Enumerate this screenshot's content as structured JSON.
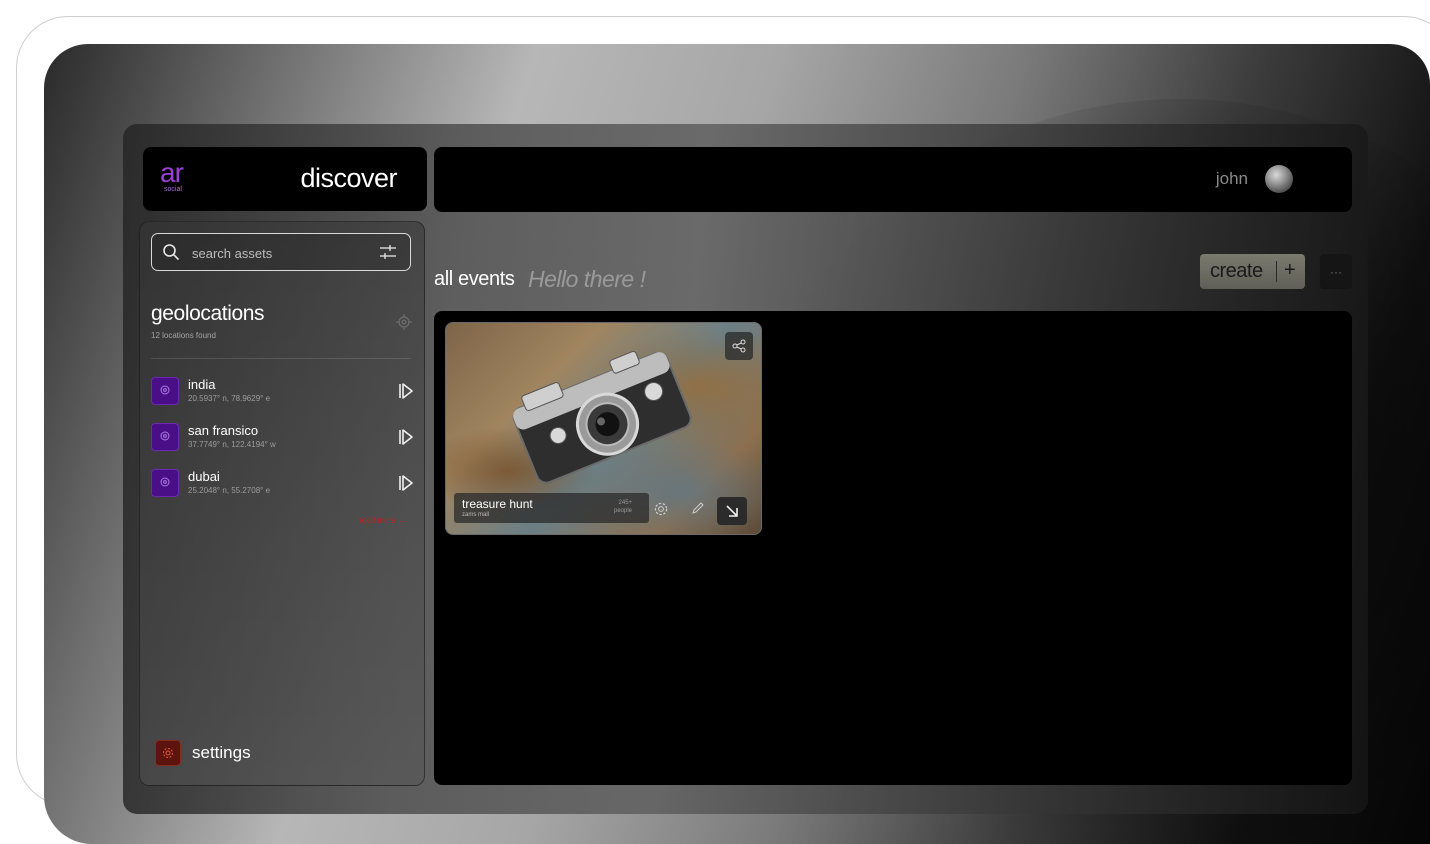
{
  "brand": {
    "logo_main": "ar",
    "logo_sub": "social",
    "accent_color": "#9b3fd6"
  },
  "header": {
    "page_title": "discover",
    "user_name": "john"
  },
  "sidebar": {
    "search": {
      "placeholder": "search assets",
      "value": ""
    },
    "geolocations": {
      "title": "geolocations",
      "subtitle": "12 locations found",
      "items": [
        {
          "name": "india",
          "coords": "20.5937° n, 78.9629° e"
        },
        {
          "name": "san fransico",
          "coords": "37.7749° n, 122.4194° w"
        },
        {
          "name": "dubai",
          "coords": "25.2048° n, 55.2708° e"
        }
      ],
      "load_more": "load more →"
    },
    "settings_label": "settings",
    "settings_color": "#5e140e"
  },
  "main": {
    "heading": "all events",
    "greeting": "Hello there !",
    "create_label": "create",
    "create_plus": "+",
    "more_label": "···",
    "events": [
      {
        "title": "treasure hunt",
        "subtitle": "zams mall",
        "count": "245+",
        "count_unit": "people"
      }
    ]
  },
  "icons": {
    "search": "search-icon",
    "filter": "sliders-icon",
    "locate": "crosshair-icon",
    "pin": "map-pin-icon",
    "play": "play-icon",
    "settings": "gear-icon",
    "share": "share-icon",
    "edit": "pencil-icon",
    "open": "arrow-down-right-icon"
  }
}
